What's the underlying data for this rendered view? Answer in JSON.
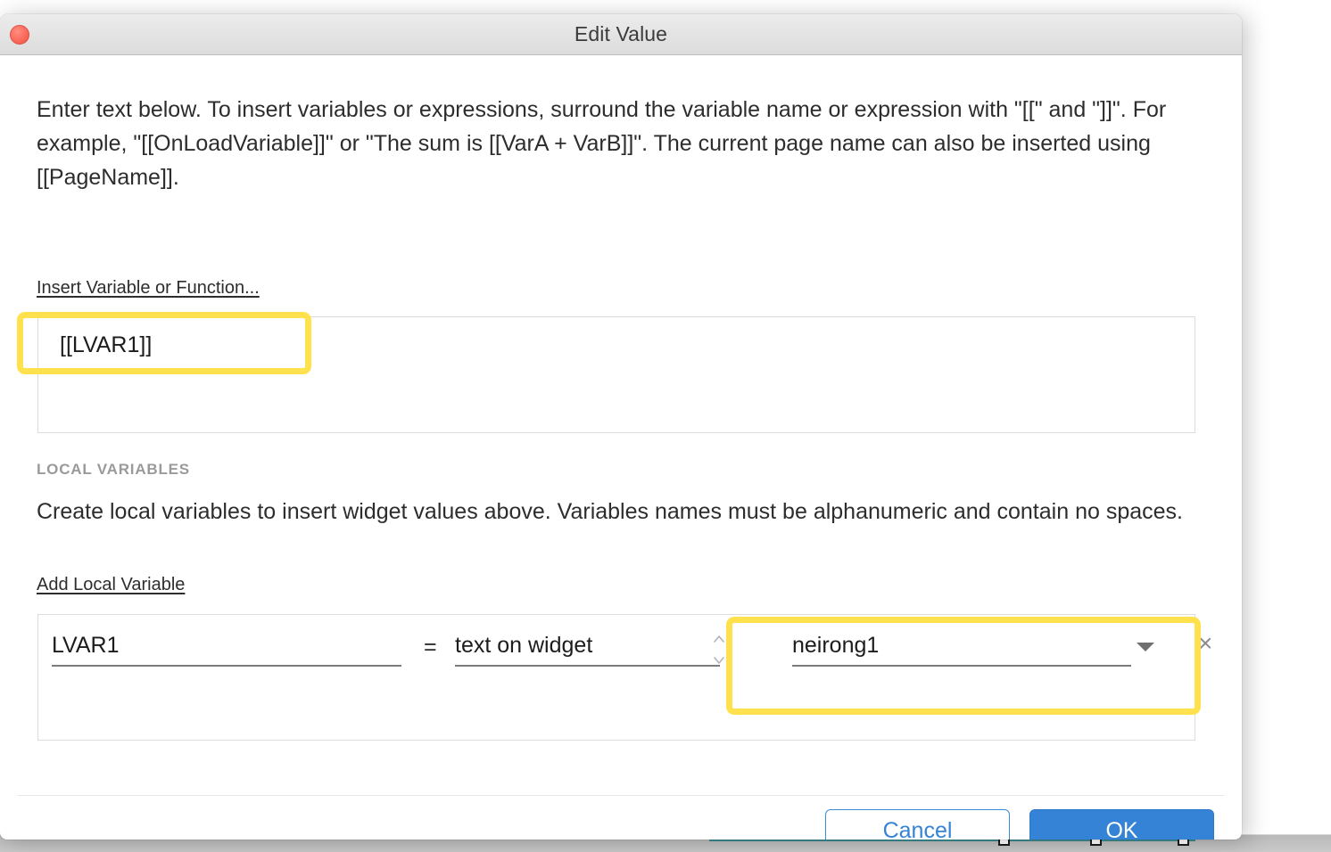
{
  "window": {
    "title": "Edit Value",
    "close_icon": "close-circle-icon"
  },
  "colors": {
    "highlight": "#ffe14d",
    "accent_blue": "#3583d6",
    "close_red": "#fa6a5c",
    "section_label": "#9a9a9a"
  },
  "body": {
    "intro": "Enter text below. To insert variables or expressions, surround the variable name or expression with \"[[\" and \"]]\". For example, \"[[OnLoadVariable]]\" or \"The sum is [[VarA + VarB]]\". The current page name can also be inserted using [[PageName]].",
    "insert_link": "Insert Variable or Function...",
    "value_textarea": "[[LVAR1]]",
    "value_textarea_placeholder": ""
  },
  "local_variables": {
    "section_label": "LOCAL VARIABLES",
    "description": "Create local variables to insert widget values above. Variables names must be alphanumeric and contain no spaces.",
    "add_link": "Add Local Variable",
    "equals_sign": "=",
    "rows": [
      {
        "name": "LVAR1",
        "name_placeholder": "",
        "type": "text on widget",
        "value": "neirong1",
        "value_placeholder": "",
        "stepper_icon": "stepper-up-down-icon",
        "dropdown_icon": "chevron-down-icon",
        "remove_icon": "close-x-icon",
        "remove_label": "×"
      }
    ]
  },
  "footer": {
    "cancel_label": "Cancel",
    "ok_label": "OK"
  }
}
